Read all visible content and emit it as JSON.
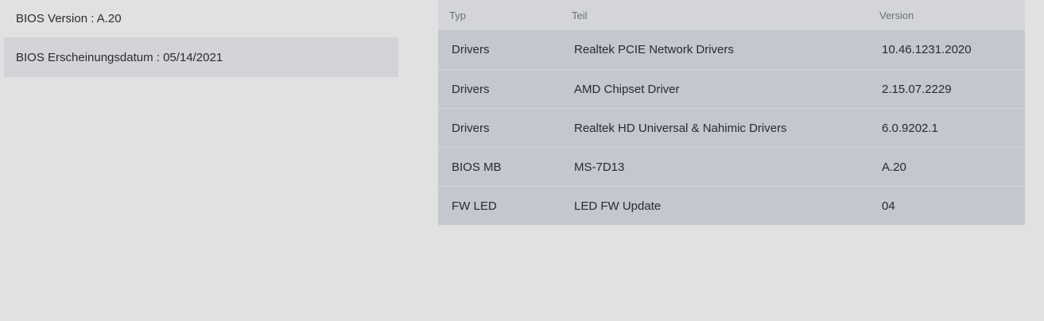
{
  "bios": {
    "version_text": "BIOS Version : A.20",
    "release_date_text": "BIOS Erscheinungsdatum : 05/14/2021"
  },
  "table": {
    "headers": {
      "typ": "Typ",
      "teil": "Teil",
      "version": "Version"
    },
    "rows": [
      {
        "typ": "Drivers",
        "teil": "Realtek PCIE Network Drivers",
        "version": "10.46.1231.2020"
      },
      {
        "typ": "Drivers",
        "teil": "AMD Chipset Driver",
        "version": "2.15.07.2229"
      },
      {
        "typ": "Drivers",
        "teil": "Realtek HD Universal & Nahimic Drivers",
        "version": "6.0.9202.1"
      },
      {
        "typ": "BIOS MB",
        "teil": "MS-7D13",
        "version": "A.20"
      },
      {
        "typ": "FW LED",
        "teil": "LED FW Update",
        "version": "04"
      }
    ]
  }
}
